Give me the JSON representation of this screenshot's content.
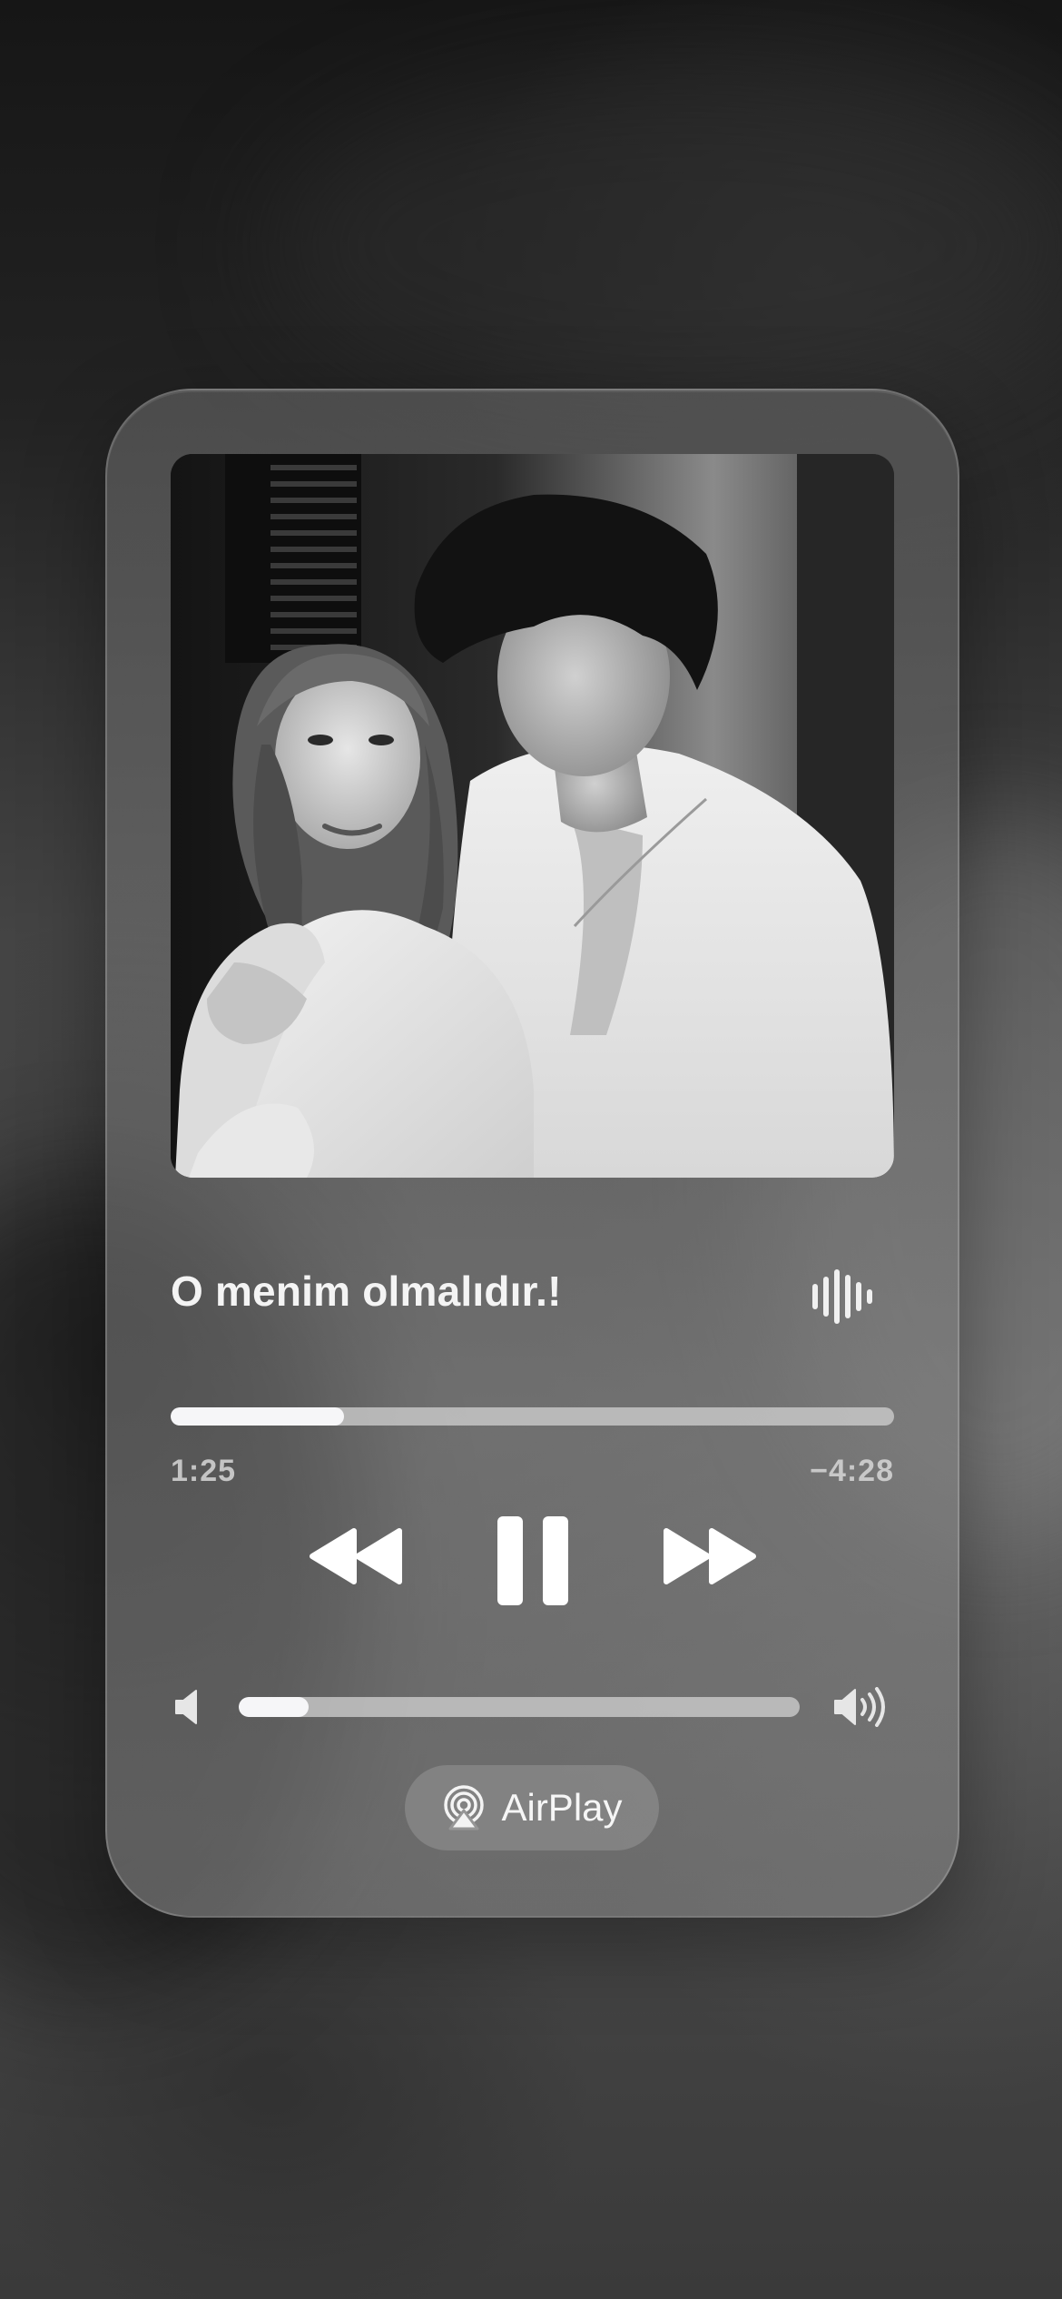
{
  "now_playing": {
    "title": "O menim olmalıdır.!",
    "elapsed": "1:25",
    "remaining": "−4:28",
    "progress": 0.24,
    "volume": 0.125
  },
  "output": {
    "airplay_label": "AirPlay"
  },
  "icons": {
    "wave": "waveform-icon",
    "rewind": "rewind-icon",
    "pause": "pause-icon",
    "forward": "fast-forward-icon",
    "volume_low": "speaker-low-icon",
    "volume_high": "speaker-high-icon",
    "airplay": "airplay-icon"
  },
  "colors": {
    "text_primary": "#f4f4f4",
    "track": "#d2d2d2",
    "fill": "#f6f6f8"
  }
}
